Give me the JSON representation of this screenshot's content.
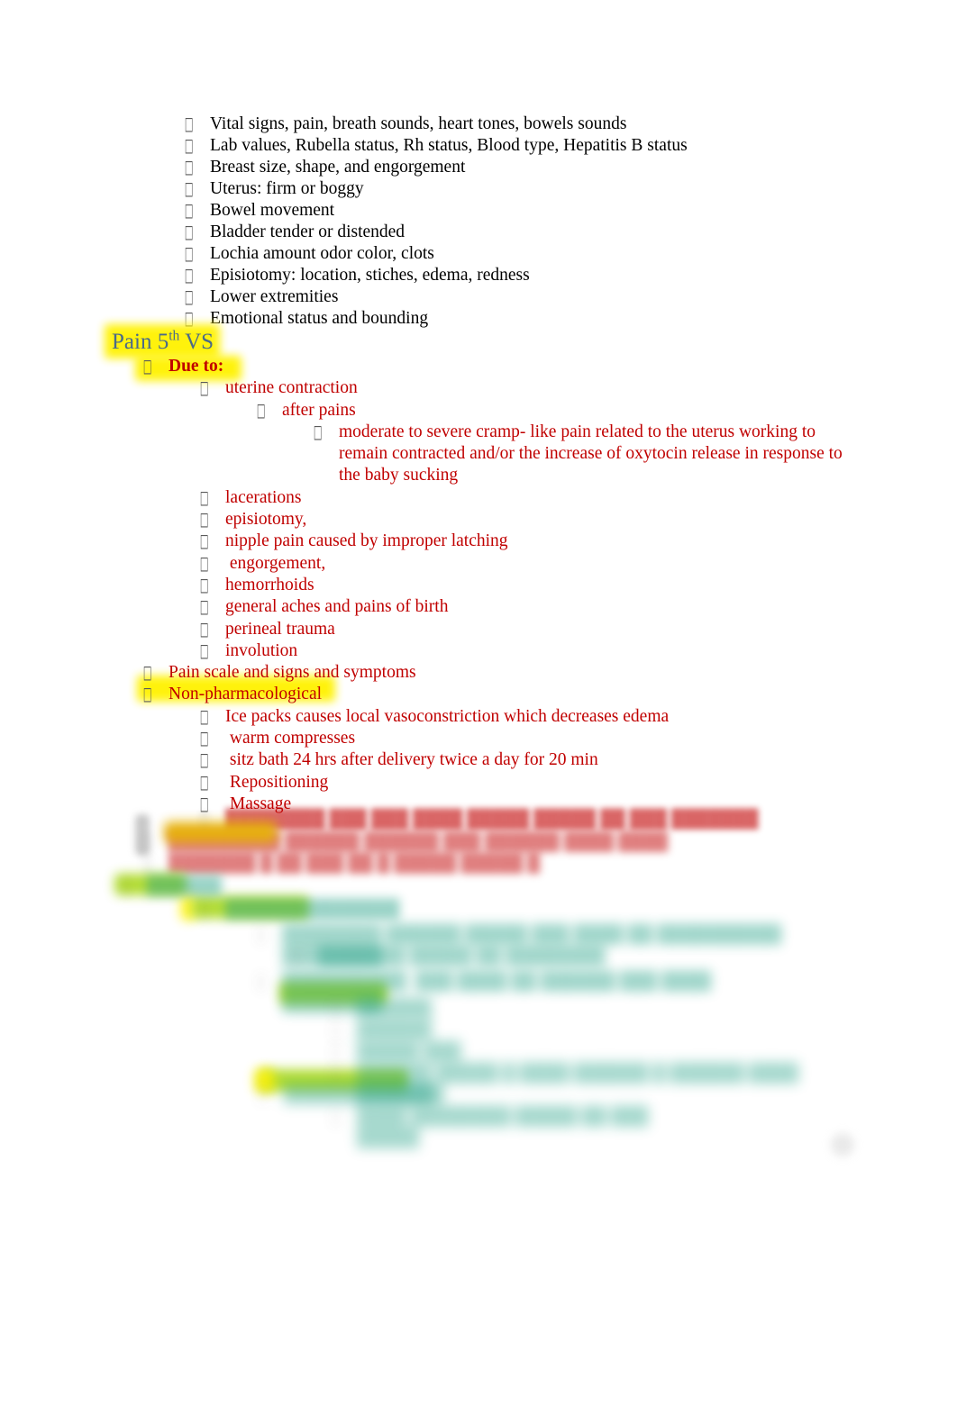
{
  "document": {
    "title": "Postpartum Assessment / Pain Notes",
    "page_background": "#ffffff",
    "bullet_glyph": "□"
  },
  "colors": {
    "body_text": "#000000",
    "red_text": "#C00000",
    "heading_blue": "#4A6A8A",
    "teal_text": "#1F9E83",
    "highlight_yellow": "#FFF200",
    "highlight_green": "#A6D713",
    "highlight_orange": "#E6B000"
  },
  "assessment_list": {
    "items": [
      {
        "text": "Vital signs, pain, breath sounds, heart tones, bowels sounds"
      },
      {
        "text": "Lab values, Rubella status, Rh status, Blood type, Hepatitis B status"
      },
      {
        "text": "Breast size, shape, and engorgement"
      },
      {
        "text": "Uterus: firm or boggy"
      },
      {
        "text": "Bowel movement"
      },
      {
        "text": "Bladder tender or distended"
      },
      {
        "text": "Lochia amount odor color, clots"
      },
      {
        "text": "Episiotomy: location, stiches, edema, redness"
      },
      {
        "text": "Lower extremities"
      },
      {
        "text": "Emotional status and bounding"
      }
    ]
  },
  "pain_section": {
    "heading_main": "Pain 5",
    "heading_sup": "th",
    "heading_tail": " VS",
    "due_to_label": "Due to:",
    "causes": [
      {
        "level": 2,
        "text": "uterine contraction"
      },
      {
        "level": 3,
        "text": "after pains"
      },
      {
        "level": 4,
        "text": "moderate to severe cramp- like pain related to the uterus working to remain contracted and/or the increase of oxytocin release in response to the baby sucking"
      },
      {
        "level": 2,
        "text": "lacerations"
      },
      {
        "level": 2,
        "text": "episiotomy,"
      },
      {
        "level": 2,
        "text": "nipple pain caused by improper latching"
      },
      {
        "level": 2,
        "text": " engorgement,"
      },
      {
        "level": 2,
        "text": "hemorrhoids"
      },
      {
        "level": 2,
        "text": "general aches and pains of birth"
      },
      {
        "level": 2,
        "text": "perineal trauma"
      },
      {
        "level": 2,
        "text": "involution"
      }
    ],
    "pain_scale_label": "Pain scale and signs and symptoms",
    "non_pharmacological_label": "Non-pharmacological",
    "non_pharmacological_items": [
      {
        "text": "Ice packs causes local vasoconstriction which decreases edema"
      },
      {
        "text": " warm compresses"
      },
      {
        "text": " sitz bath 24 hrs after delivery twice a day for 20 min"
      },
      {
        "text": " Repositioning"
      },
      {
        "text": " Massage"
      }
    ]
  },
  "redacted_section": {
    "note": "Lower portion of the page is blurred and illegible in the source image.",
    "lines": [
      {
        "level": 2,
        "color": "red",
        "blur": 1,
        "text": "████████ ███ ███ ████ █████ █████ ██ ███ ███████"
      },
      {
        "level": 1,
        "color": "red",
        "blur": 2,
        "text": "█████████ ██████ ██████ ███ ██████ ████ ████"
      },
      {
        "level": 1,
        "color": "red",
        "blur": 2,
        "text": "███████ █ ██ ███ ██ █ █████ █████ █"
      },
      {
        "level": 0,
        "color": "teal",
        "blur": 3,
        "text": "██████"
      },
      {
        "level": 2,
        "color": "teal",
        "blur": 3,
        "text": "██████████████"
      },
      {
        "level": 3,
        "color": "teal",
        "blur": 4,
        "text": "████████ ██████ █████ ███ ████ ██ ██████████ ████████"
      },
      {
        "level": 3,
        "color": "teal",
        "blur": 4,
        "text": "███████ █████ ██ ████████"
      },
      {
        "level": 3,
        "color": "teal",
        "blur": 4,
        "text": "██████████  ███ ████ ██ ██████ ███ ████ ████████"
      },
      {
        "level": 4,
        "color": "teal",
        "blur": 5,
        "text": "██████"
      },
      {
        "level": 4,
        "color": "teal",
        "blur": 5,
        "text": "██████"
      },
      {
        "level": 4,
        "color": "teal",
        "blur": 5,
        "text": "█████ ███"
      },
      {
        "level": 4,
        "color": "teal",
        "blur": 5,
        "text": "██████ █████ █ ████ ██████ █ ██████ ████ ███████"
      },
      {
        "level": 2,
        "color": "teal",
        "blur": 5,
        "text": "████████████"
      },
      {
        "level": 4,
        "color": "teal",
        "blur": 5,
        "text": "████ ████████ █████ ██ ███ █████"
      }
    ]
  }
}
